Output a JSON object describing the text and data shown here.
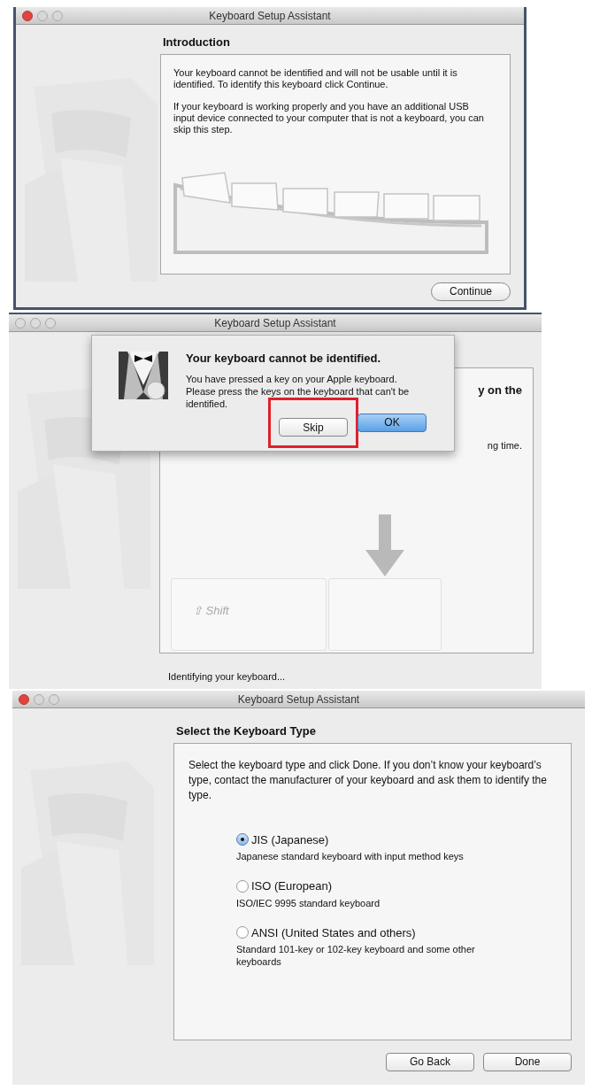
{
  "windows": [
    {
      "kind": "intro",
      "title": "Keyboard Setup Assistant",
      "active": true,
      "heading": "Introduction",
      "paragraphs": [
        "Your keyboard cannot be identified and will not be usable until it is identified. To identify this keyboard click Continue.",
        "If your keyboard is working properly and you have an additional USB input device connected to your computer that is not a keyboard, you can skip this step."
      ],
      "buttons": [
        {
          "label": "Continue",
          "default": false
        }
      ]
    },
    {
      "kind": "identify",
      "title": "Keyboard Setup Assistant",
      "active": false,
      "fragments": [
        "y on the",
        "ng time."
      ],
      "key_label": "⇧ Shift",
      "status": "Identifying your keyboard...",
      "dialog": {
        "title": "Your keyboard cannot be identified.",
        "message": "You have pressed a key on your Apple keyboard. Please press the keys on the keyboard that can't be identified.",
        "buttons": [
          {
            "label": "Skip",
            "default": false,
            "highlighted": true
          },
          {
            "label": "OK",
            "default": true,
            "highlighted": false
          }
        ]
      }
    },
    {
      "kind": "select",
      "title": "Keyboard Setup Assistant",
      "active": true,
      "heading": "Select the Keyboard Type",
      "paragraphs": [
        "Select the keyboard type and click Done. If you don’t know your keyboard’s type, contact the manufacturer of your keyboard and ask them to identify the type."
      ],
      "options": [
        {
          "label": "JIS (Japanese)",
          "description": "Japanese standard keyboard with input method keys",
          "selected": true
        },
        {
          "label": "ISO (European)",
          "description": "ISO/IEC 9995 standard keyboard",
          "selected": false
        },
        {
          "label": "ANSI (United States and others)",
          "description": "Standard 101-key or 102-key keyboard and some other keyboards",
          "selected": false
        }
      ],
      "buttons": [
        {
          "label": "Go Back",
          "default": false
        },
        {
          "label": "Done",
          "default": false
        }
      ]
    }
  ]
}
